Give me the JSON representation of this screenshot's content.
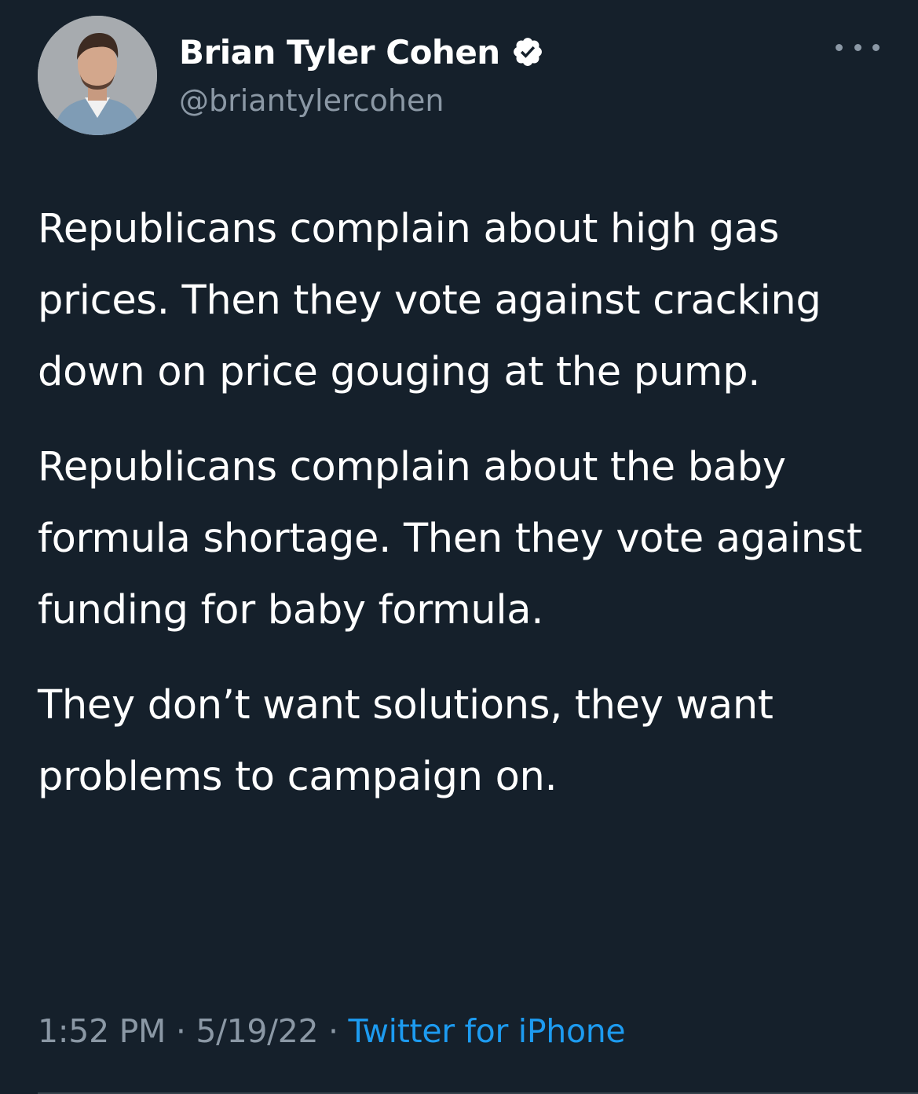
{
  "author": {
    "display_name": "Brian Tyler Cohen",
    "handle": "@briantylercohen",
    "verified": true
  },
  "icons": {
    "verified": "verified-badge-icon",
    "more": "more-options-icon"
  },
  "tweet": {
    "paragraphs": [
      "Republicans complain about high gas prices. Then they vote against cracking down on price gouging at the pump.",
      "Republicans complain about the baby formula shortage. Then they vote against funding for baby formula.",
      "They don’t want solutions, they want problems to campaign on."
    ]
  },
  "meta": {
    "time": "1:52 PM",
    "separator": " · ",
    "date": "5/19/22",
    "source": "Twitter for iPhone"
  },
  "colors": {
    "background": "#15202b",
    "text": "#ffffff",
    "secondary_text": "#8b98a5",
    "link": "#1d9bf0"
  }
}
